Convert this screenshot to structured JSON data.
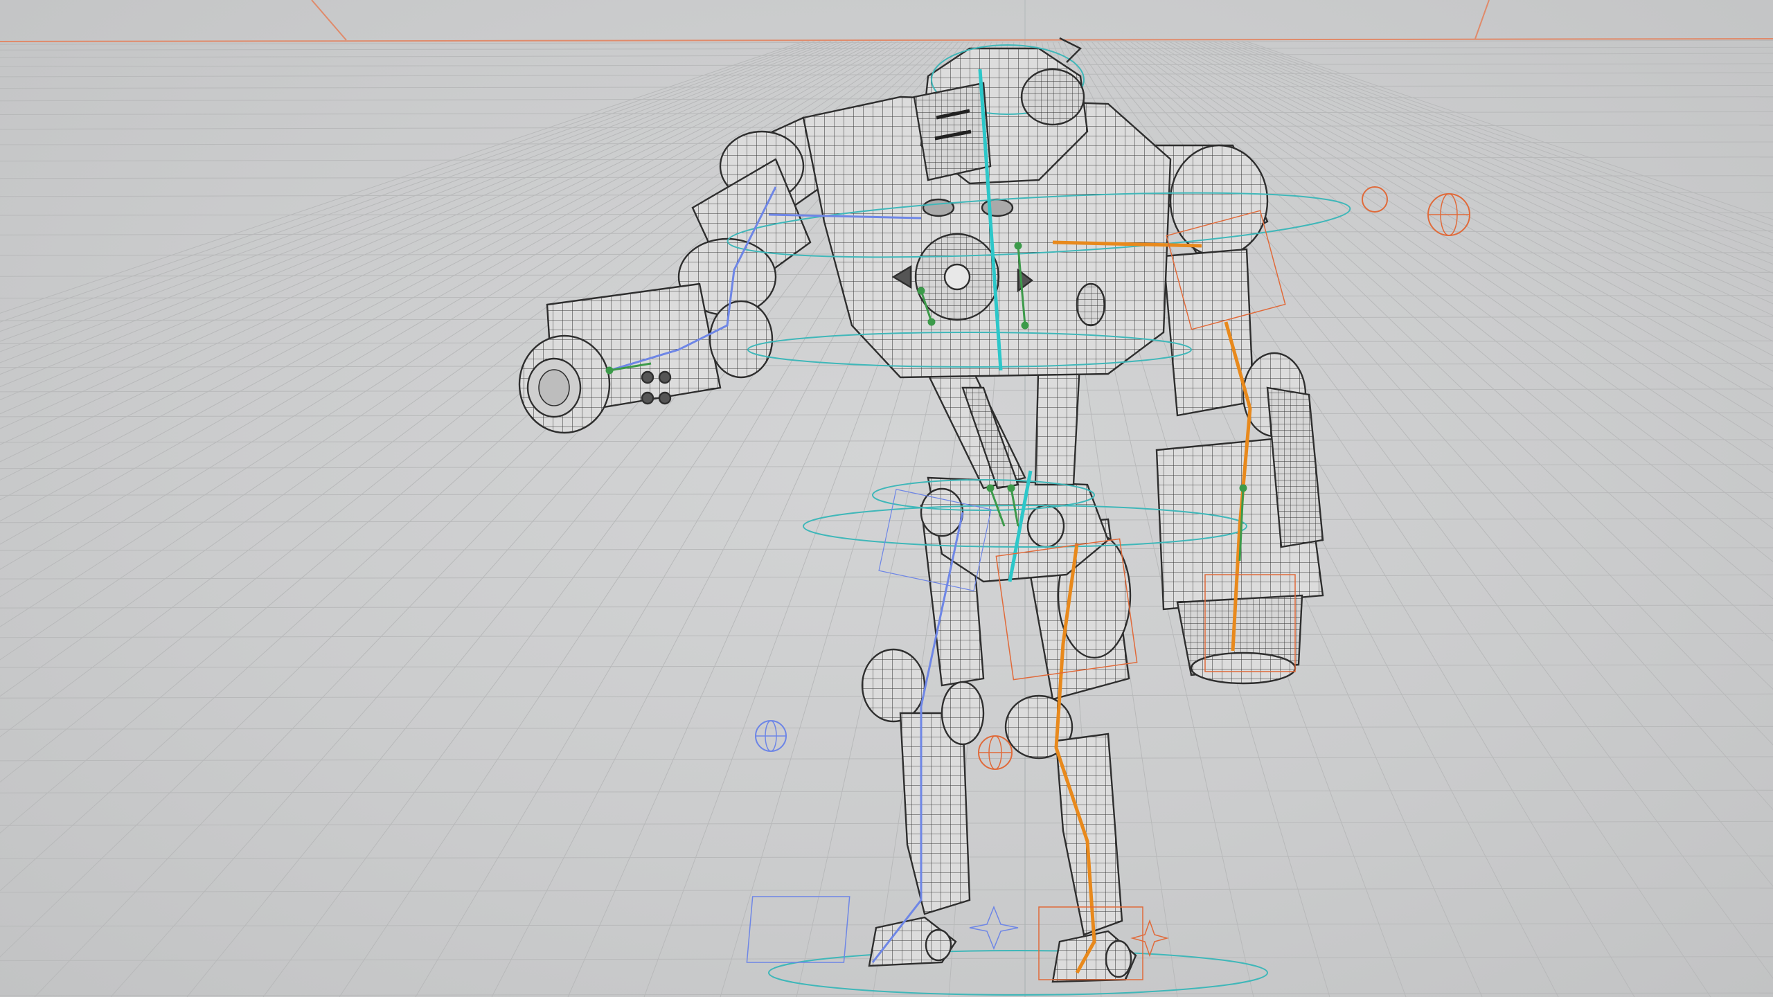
{
  "viewport": {
    "background": "#cbcccd",
    "grid_color": "#b8b9ba",
    "horizon_axis_color": "#e08a6a"
  },
  "rig_colors": {
    "mesh_wire": "#3c3c3c",
    "mesh_fill": "#dcdcdc",
    "spine_chain": "#2cc7c9",
    "left_chain": "#6e86e6",
    "right_chain": "#e8891c",
    "controls_ik": "#3c9a4a",
    "ik_box_orange": "#e06a3a",
    "pivot_rings": "#3fb7b9"
  }
}
